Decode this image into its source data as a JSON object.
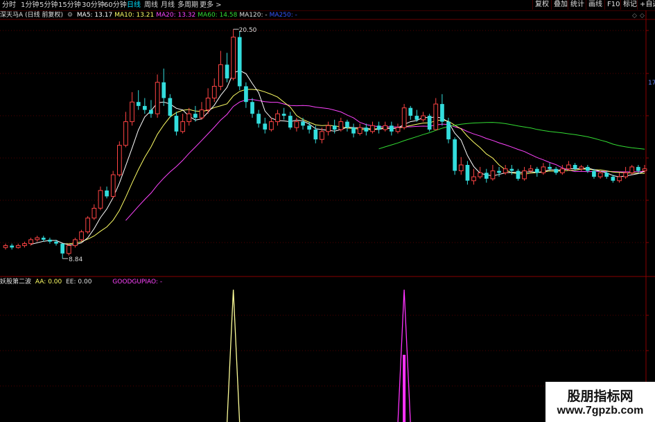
{
  "period_tabs": [
    "分时",
    "1分钟",
    "5分钟",
    "15分钟",
    "30分钟",
    "60分钟",
    "日线",
    "周线",
    "月线",
    "多周期",
    "更多 >"
  ],
  "active_tab": "日线",
  "right_buttons": [
    "复权",
    "叠加",
    "统计",
    "画线",
    "F10",
    "标记",
    "+自选"
  ],
  "stock": {
    "name": "深天马A",
    "mode": "(日线 前复权)"
  },
  "ma_legend": [
    {
      "label": "MA5: 13.17",
      "color": "#ffffff"
    },
    {
      "label": "MA10: 13.21",
      "color": "#ffff66"
    },
    {
      "label": "MA20: 13.32",
      "color": "#ff44ff"
    },
    {
      "label": "MA60: 14.58",
      "color": "#33dd33"
    },
    {
      "label": "MA120: -",
      "color": "#dddddd"
    },
    {
      "label": "MA250: -",
      "color": "#3355ff"
    }
  ],
  "price_axis_label": "17",
  "high_annotation": "20.50",
  "low_annotation": "8.84",
  "indicator": {
    "name": "妖股第二波",
    "aa": "AA: 0.00",
    "ee": "EE: 0.00",
    "tag": "GOODGUPIAO: -"
  },
  "watermark": {
    "title": "股朋指标网",
    "url": "www.7gpzb.com"
  },
  "colors": {
    "up": "#ff4444",
    "down": "#33dddd",
    "ma5": "#ffffff",
    "ma10": "#ffff66",
    "ma20": "#ff44ff",
    "ma60": "#33dd33",
    "grid": "#550000"
  },
  "chart_data": {
    "type": "candlestick",
    "price_range_visible": [
      8.84,
      20.5
    ],
    "candles": [
      {
        "o": 9.4,
        "c": 9.5,
        "h": 9.6,
        "l": 9.3
      },
      {
        "o": 9.5,
        "c": 9.4,
        "h": 9.6,
        "l": 9.3
      },
      {
        "o": 9.4,
        "c": 9.5,
        "h": 9.6,
        "l": 9.35
      },
      {
        "o": 9.5,
        "c": 9.6,
        "h": 9.7,
        "l": 9.4
      },
      {
        "o": 9.6,
        "c": 9.8,
        "h": 9.9,
        "l": 9.5
      },
      {
        "o": 9.8,
        "c": 9.9,
        "h": 10.0,
        "l": 9.7
      },
      {
        "o": 9.9,
        "c": 9.8,
        "h": 10.0,
        "l": 9.7
      },
      {
        "o": 9.8,
        "c": 9.7,
        "h": 9.9,
        "l": 9.6
      },
      {
        "o": 9.7,
        "c": 9.6,
        "h": 9.8,
        "l": 9.5
      },
      {
        "o": 9.6,
        "c": 9.1,
        "h": 9.6,
        "l": 8.84
      },
      {
        "o": 9.1,
        "c": 9.5,
        "h": 9.6,
        "l": 9.0
      },
      {
        "o": 9.5,
        "c": 9.8,
        "h": 9.9,
        "l": 9.4
      },
      {
        "o": 9.8,
        "c": 10.2,
        "h": 10.3,
        "l": 9.7
      },
      {
        "o": 10.2,
        "c": 10.9,
        "h": 11.0,
        "l": 10.1
      },
      {
        "o": 10.9,
        "c": 11.4,
        "h": 11.6,
        "l": 10.8
      },
      {
        "o": 11.4,
        "c": 12.3,
        "h": 12.5,
        "l": 11.3
      },
      {
        "o": 12.3,
        "c": 12.0,
        "h": 12.5,
        "l": 11.9
      },
      {
        "o": 12.0,
        "c": 13.1,
        "h": 13.3,
        "l": 11.9
      },
      {
        "o": 13.1,
        "c": 14.6,
        "h": 14.8,
        "l": 13.0
      },
      {
        "o": 14.6,
        "c": 15.8,
        "h": 16.3,
        "l": 14.5
      },
      {
        "o": 15.8,
        "c": 16.8,
        "h": 17.3,
        "l": 15.6
      },
      {
        "o": 16.8,
        "c": 16.6,
        "h": 17.4,
        "l": 16.4
      },
      {
        "o": 16.6,
        "c": 16.4,
        "h": 17.0,
        "l": 16.2
      },
      {
        "o": 16.4,
        "c": 16.2,
        "h": 16.9,
        "l": 16.0
      },
      {
        "o": 16.2,
        "c": 17.8,
        "h": 18.2,
        "l": 16.0
      },
      {
        "o": 17.8,
        "c": 17.0,
        "h": 18.5,
        "l": 16.6
      },
      {
        "o": 17.0,
        "c": 16.1,
        "h": 17.2,
        "l": 16.0
      },
      {
        "o": 16.1,
        "c": 15.3,
        "h": 16.3,
        "l": 15.1
      },
      {
        "o": 15.3,
        "c": 15.8,
        "h": 16.2,
        "l": 15.2
      },
      {
        "o": 15.8,
        "c": 16.2,
        "h": 16.5,
        "l": 15.6
      },
      {
        "o": 16.2,
        "c": 16.0,
        "h": 16.6,
        "l": 15.8
      },
      {
        "o": 16.0,
        "c": 16.4,
        "h": 16.8,
        "l": 15.9
      },
      {
        "o": 16.4,
        "c": 17.0,
        "h": 17.5,
        "l": 16.2
      },
      {
        "o": 17.0,
        "c": 17.6,
        "h": 18.0,
        "l": 16.8
      },
      {
        "o": 17.6,
        "c": 18.7,
        "h": 19.4,
        "l": 17.4
      },
      {
        "o": 18.7,
        "c": 18.0,
        "h": 19.3,
        "l": 17.8
      },
      {
        "o": 18.0,
        "c": 20.1,
        "h": 20.5,
        "l": 17.9
      },
      {
        "o": 20.1,
        "c": 17.6,
        "h": 20.4,
        "l": 17.4
      },
      {
        "o": 17.6,
        "c": 16.8,
        "h": 17.8,
        "l": 16.5
      },
      {
        "o": 16.8,
        "c": 16.2,
        "h": 17.0,
        "l": 16.0
      },
      {
        "o": 16.2,
        "c": 15.7,
        "h": 16.4,
        "l": 15.5
      },
      {
        "o": 15.7,
        "c": 15.4,
        "h": 16.0,
        "l": 15.2
      },
      {
        "o": 15.4,
        "c": 15.8,
        "h": 16.0,
        "l": 15.3
      },
      {
        "o": 15.8,
        "c": 16.2,
        "h": 16.4,
        "l": 15.6
      },
      {
        "o": 16.2,
        "c": 16.1,
        "h": 16.5,
        "l": 15.9
      },
      {
        "o": 16.1,
        "c": 15.5,
        "h": 16.3,
        "l": 15.4
      },
      {
        "o": 15.5,
        "c": 15.8,
        "h": 16.0,
        "l": 15.3
      },
      {
        "o": 15.8,
        "c": 15.6,
        "h": 16.0,
        "l": 15.4
      },
      {
        "o": 15.6,
        "c": 15.4,
        "h": 15.8,
        "l": 15.2
      },
      {
        "o": 15.4,
        "c": 14.9,
        "h": 15.6,
        "l": 14.7
      },
      {
        "o": 14.9,
        "c": 15.3,
        "h": 15.5,
        "l": 14.7
      },
      {
        "o": 15.3,
        "c": 15.6,
        "h": 15.8,
        "l": 15.1
      },
      {
        "o": 15.6,
        "c": 15.4,
        "h": 15.9,
        "l": 15.2
      },
      {
        "o": 15.4,
        "c": 15.8,
        "h": 16.0,
        "l": 15.3
      },
      {
        "o": 15.8,
        "c": 15.5,
        "h": 15.9,
        "l": 15.3
      },
      {
        "o": 15.5,
        "c": 15.2,
        "h": 15.7,
        "l": 15.0
      },
      {
        "o": 15.2,
        "c": 15.5,
        "h": 15.7,
        "l": 15.1
      },
      {
        "o": 15.5,
        "c": 15.3,
        "h": 15.7,
        "l": 15.1
      },
      {
        "o": 15.3,
        "c": 15.6,
        "h": 15.8,
        "l": 15.2
      },
      {
        "o": 15.6,
        "c": 15.4,
        "h": 15.8,
        "l": 15.2
      },
      {
        "o": 15.4,
        "c": 15.6,
        "h": 15.8,
        "l": 15.3
      },
      {
        "o": 15.6,
        "c": 15.3,
        "h": 15.8,
        "l": 15.1
      },
      {
        "o": 15.3,
        "c": 15.5,
        "h": 15.7,
        "l": 15.2
      },
      {
        "o": 15.5,
        "c": 16.5,
        "h": 16.7,
        "l": 15.4
      },
      {
        "o": 16.5,
        "c": 16.1,
        "h": 16.6,
        "l": 15.9
      },
      {
        "o": 16.1,
        "c": 15.9,
        "h": 16.4,
        "l": 15.8
      },
      {
        "o": 15.9,
        "c": 16.1,
        "h": 16.3,
        "l": 15.8
      },
      {
        "o": 16.1,
        "c": 15.4,
        "h": 16.2,
        "l": 15.3
      },
      {
        "o": 15.4,
        "c": 16.7,
        "h": 17.0,
        "l": 15.4
      },
      {
        "o": 16.7,
        "c": 15.8,
        "h": 17.2,
        "l": 15.6
      },
      {
        "o": 15.8,
        "c": 14.9,
        "h": 16.0,
        "l": 14.7
      },
      {
        "o": 14.9,
        "c": 13.3,
        "h": 15.0,
        "l": 13.1
      },
      {
        "o": 13.3,
        "c": 13.6,
        "h": 14.0,
        "l": 13.1
      },
      {
        "o": 13.6,
        "c": 12.8,
        "h": 13.8,
        "l": 12.6
      },
      {
        "o": 12.8,
        "c": 13.0,
        "h": 13.4,
        "l": 12.6
      },
      {
        "o": 13.0,
        "c": 13.2,
        "h": 13.5,
        "l": 12.9
      },
      {
        "o": 13.2,
        "c": 12.9,
        "h": 13.4,
        "l": 12.7
      },
      {
        "o": 12.9,
        "c": 13.3,
        "h": 13.6,
        "l": 12.8
      },
      {
        "o": 13.3,
        "c": 13.2,
        "h": 13.5,
        "l": 13.0
      },
      {
        "o": 13.2,
        "c": 13.4,
        "h": 13.6,
        "l": 13.1
      },
      {
        "o": 13.4,
        "c": 13.3,
        "h": 13.6,
        "l": 13.1
      },
      {
        "o": 13.3,
        "c": 12.9,
        "h": 13.4,
        "l": 12.8
      },
      {
        "o": 12.9,
        "c": 13.3,
        "h": 13.5,
        "l": 12.8
      },
      {
        "o": 13.3,
        "c": 13.4,
        "h": 13.6,
        "l": 13.2
      },
      {
        "o": 13.4,
        "c": 13.2,
        "h": 13.5,
        "l": 13.0
      },
      {
        "o": 13.2,
        "c": 13.5,
        "h": 13.7,
        "l": 13.1
      },
      {
        "o": 13.5,
        "c": 13.4,
        "h": 13.7,
        "l": 13.3
      },
      {
        "o": 13.4,
        "c": 13.2,
        "h": 13.5,
        "l": 13.1
      },
      {
        "o": 13.2,
        "c": 13.4,
        "h": 13.6,
        "l": 13.1
      },
      {
        "o": 13.4,
        "c": 13.6,
        "h": 13.8,
        "l": 13.3
      },
      {
        "o": 13.6,
        "c": 13.4,
        "h": 13.7,
        "l": 13.3
      },
      {
        "o": 13.4,
        "c": 13.5,
        "h": 13.6,
        "l": 13.3
      },
      {
        "o": 13.5,
        "c": 13.3,
        "h": 13.6,
        "l": 13.2
      },
      {
        "o": 13.3,
        "c": 13.0,
        "h": 13.4,
        "l": 12.9
      },
      {
        "o": 13.0,
        "c": 13.2,
        "h": 13.3,
        "l": 12.9
      },
      {
        "o": 13.2,
        "c": 13.0,
        "h": 13.3,
        "l": 12.9
      },
      {
        "o": 13.0,
        "c": 12.8,
        "h": 13.1,
        "l": 12.7
      },
      {
        "o": 12.8,
        "c": 13.0,
        "h": 13.2,
        "l": 12.7
      },
      {
        "o": 13.0,
        "c": 13.2,
        "h": 13.5,
        "l": 12.9
      },
      {
        "o": 13.2,
        "c": 13.5,
        "h": 13.6,
        "l": 13.1
      },
      {
        "o": 13.5,
        "c": 13.3,
        "h": 13.6,
        "l": 13.2
      },
      {
        "o": 13.3,
        "c": 13.4,
        "h": 13.6,
        "l": 13.2
      }
    ],
    "indicator_spikes": [
      {
        "bar": 36,
        "series": "AA",
        "color": "#ffff99"
      },
      {
        "bar": 63,
        "series": "EE",
        "color": "#ff33ff"
      }
    ]
  }
}
